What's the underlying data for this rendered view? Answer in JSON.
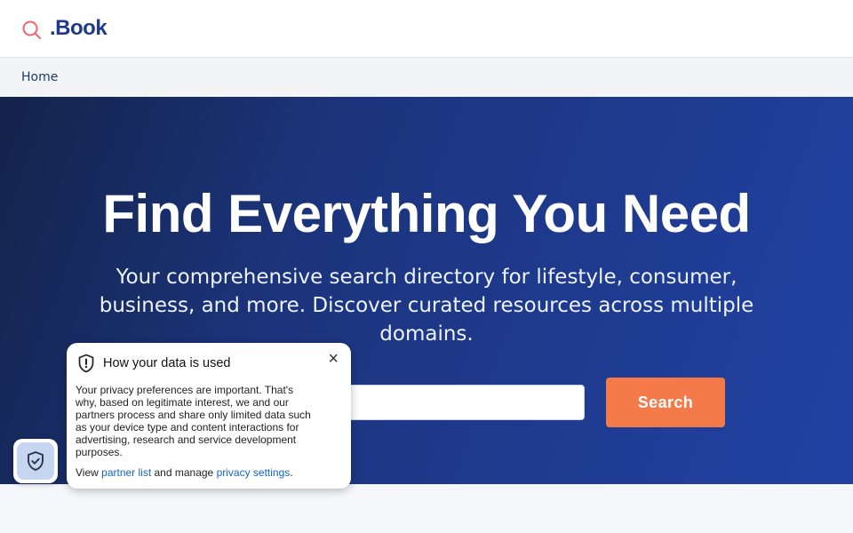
{
  "header": {
    "logo_text": ".Book",
    "logo_icon": "search-icon"
  },
  "breadcrumb": {
    "home": "Home"
  },
  "hero": {
    "title": "Find Everything You Need",
    "subtitle": "Your comprehensive search directory for lifestyle, consumer, business, and more. Discover curated resources across multiple domains.",
    "search": {
      "value": "",
      "placeholder": ""
    },
    "search_button": "Search"
  },
  "privacy_popup": {
    "icon": "shield-exclamation-icon",
    "title": "How your data is used",
    "close_label": "×",
    "body": "Your privacy preferences are important. That's why, based on legitimate interest, we and our partners process and share only limited data such as your device type and content interactions for advertising, research and service development purposes.",
    "footer_prefix": "View ",
    "partner_link": "partner list",
    "footer_middle": " and manage ",
    "settings_link": "privacy settings",
    "footer_suffix": "."
  },
  "privacy_badge": {
    "icon": "shield-check-icon"
  },
  "colors": {
    "brand": "#1e3a8a",
    "hero_start": "#13234a",
    "hero_end": "#2142a4",
    "button": "#f47a4a",
    "link": "#1565c0"
  }
}
